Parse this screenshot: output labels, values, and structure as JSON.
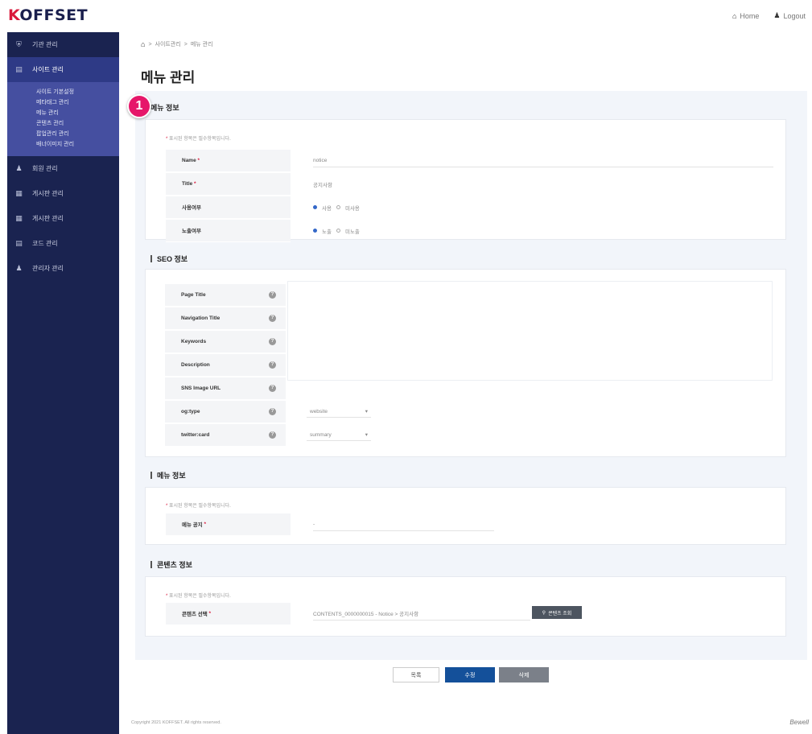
{
  "header": {
    "logo_k": "K",
    "logo_rest": "OFFSET",
    "home_label": "Home",
    "logout_label": "Logout"
  },
  "sidebar": {
    "items": [
      {
        "label": "기관 관리",
        "icon": "shield-icon"
      },
      {
        "label": "사이트 관리",
        "icon": "document-icon",
        "active": true
      },
      {
        "label": "회원 관리",
        "icon": "user-icon"
      },
      {
        "label": "게시판 관리",
        "icon": "grid-icon"
      },
      {
        "label": "게시판 관리",
        "icon": "grid-icon"
      },
      {
        "label": "코드 관리",
        "icon": "document-icon"
      },
      {
        "label": "관리자 관리",
        "icon": "user-icon"
      }
    ],
    "subitems": [
      "사이트 기본설정",
      "메타태그 관리",
      "메뉴 관리",
      "콘텐츠 관리",
      "팝업관리 관리",
      "배너이미지 관리"
    ]
  },
  "breadcrumb": {
    "home": "⌂",
    "sep": ">",
    "level1": "사이트관리",
    "level2": "메뉴 관리"
  },
  "page_title": "메뉴 관리",
  "badge_label": "1",
  "sections": {
    "menu_info": {
      "title": "메뉴 정보",
      "note": "표시된 항목은 필수항목입니다.",
      "rows": [
        {
          "label": "Name",
          "value": "notice"
        },
        {
          "label": "Title",
          "value": "공지사항"
        },
        {
          "label": "사용여부",
          "opt_on": "사용",
          "opt_off": "미사용"
        },
        {
          "label": "노출여부",
          "opt_on": "노출",
          "opt_off": "미노출"
        }
      ]
    },
    "seo_info": {
      "title": "SEO 정보",
      "rows": [
        {
          "label": "Page Title"
        },
        {
          "label": "Navigation Title"
        },
        {
          "label": "Keywords"
        },
        {
          "label": "Description"
        },
        {
          "label": "SNS Image URL"
        },
        {
          "label": "og:type",
          "value": "website"
        },
        {
          "label": "twitter:card",
          "value": "summary"
        }
      ]
    },
    "menu_link": {
      "title": "메뉴 정보",
      "note": "표시된 항목은 필수항목입니다.",
      "row_label": "메뉴 공지",
      "row_value": "-"
    },
    "content_info": {
      "title": "콘텐츠 정보",
      "note": "표시된 항목은 필수항목입니다.",
      "row_label": "콘텐츠 선택",
      "row_value": "CONTENTS_0000000015 - Notice > 공지사항",
      "search_button": "콘텐츠 조회"
    }
  },
  "buttons": {
    "list": "목록",
    "edit": "수정",
    "delete": "삭제"
  },
  "footer": {
    "copyright": "Copyright 2021 KOFFSET. All rights reserved.",
    "brand": "Bewell"
  }
}
